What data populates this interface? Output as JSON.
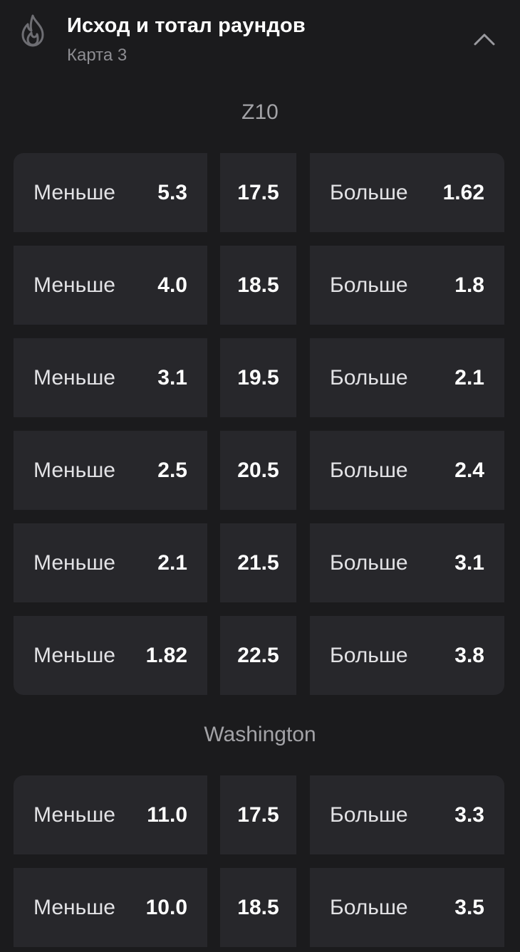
{
  "header": {
    "title": "Исход и тотал раундов",
    "subtitle": "Карта 3",
    "icon": "flame-icon",
    "collapse_icon": "chevron-up-icon"
  },
  "colors": {
    "background": "#1b1b1d",
    "cell": "#27272b",
    "muted": "#8d8d92"
  },
  "markets": [
    {
      "team": "Z10",
      "rows": [
        {
          "under_label": "Меньше",
          "under_odd": "5.3",
          "total": "17.5",
          "over_label": "Больше",
          "over_odd": "1.62"
        },
        {
          "under_label": "Меньше",
          "under_odd": "4.0",
          "total": "18.5",
          "over_label": "Больше",
          "over_odd": "1.8"
        },
        {
          "under_label": "Меньше",
          "under_odd": "3.1",
          "total": "19.5",
          "over_label": "Больше",
          "over_odd": "2.1"
        },
        {
          "under_label": "Меньше",
          "under_odd": "2.5",
          "total": "20.5",
          "over_label": "Больше",
          "over_odd": "2.4"
        },
        {
          "under_label": "Меньше",
          "under_odd": "2.1",
          "total": "21.5",
          "over_label": "Больше",
          "over_odd": "3.1"
        },
        {
          "under_label": "Меньше",
          "under_odd": "1.82",
          "total": "22.5",
          "over_label": "Больше",
          "over_odd": "3.8"
        }
      ]
    },
    {
      "team": "Washington",
      "rows": [
        {
          "under_label": "Меньше",
          "under_odd": "11.0",
          "total": "17.5",
          "over_label": "Больше",
          "over_odd": "3.3"
        },
        {
          "under_label": "Меньше",
          "under_odd": "10.0",
          "total": "18.5",
          "over_label": "Больше",
          "over_odd": "3.5"
        }
      ]
    }
  ]
}
